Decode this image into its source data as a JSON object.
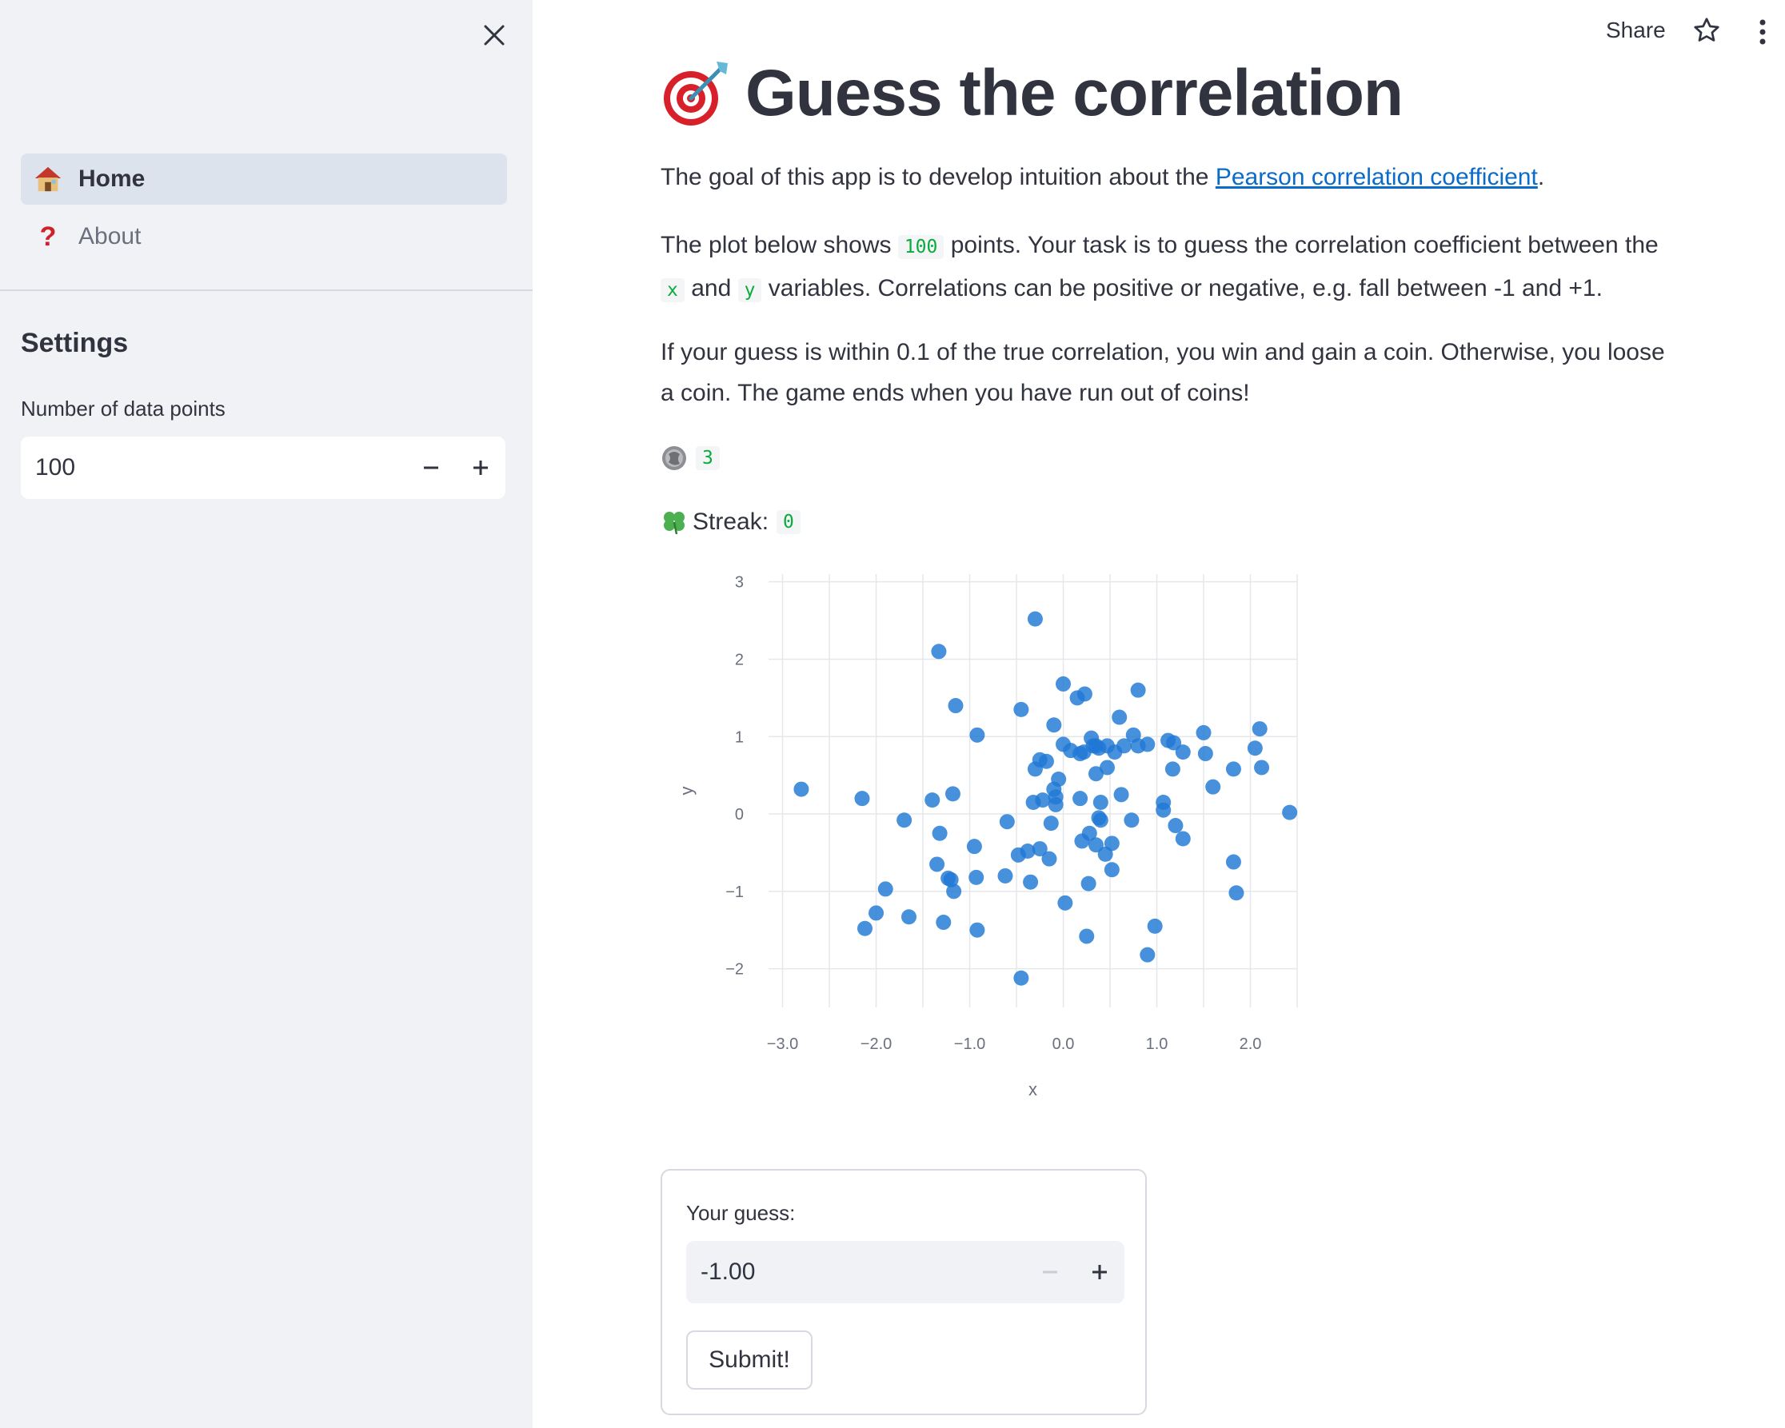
{
  "sidebar": {
    "nav": [
      {
        "label": "Home",
        "icon": "house-icon",
        "active": true
      },
      {
        "label": "About",
        "icon": "question-mark-icon",
        "active": false
      }
    ],
    "settings_title": "Settings",
    "points_label": "Number of data points",
    "points_value": "100"
  },
  "header": {
    "share_label": "Share"
  },
  "main": {
    "title": "Guess the correlation",
    "intro_prefix": "The goal of this app is to develop intuition about the ",
    "intro_link": "Pearson correlation coefficient",
    "intro_suffix": ".",
    "task_1": "The plot below shows ",
    "task_points": "100",
    "task_2": " points. Your task is to guess the correlation coefficient between the ",
    "task_x": "x",
    "task_3": " and ",
    "task_y": "y",
    "task_4": " variables. Correlations can be positive or negative, e.g. fall between -1 and +1.",
    "rules": "If your guess is within 0.1 of the true correlation, you win and gain a coin. Otherwise, you loose a coin. The game ends when you have run out of coins!",
    "coins": "3",
    "streak_label": "Streak:",
    "streak_value": "0",
    "guess_label": "Your guess:",
    "guess_value": "-1.00",
    "submit_label": "Submit!"
  },
  "colors": {
    "point": "#1f77d4",
    "accent_link": "#0b6bc8",
    "code_green": "#09ab3b"
  },
  "chart_data": {
    "type": "scatter",
    "xlabel": "x",
    "ylabel": "y",
    "xlim": [
      -3.15,
      2.5
    ],
    "ylim": [
      -2.5,
      3.1
    ],
    "xticks": [
      -3.0,
      -2.0,
      -1.0,
      0.0,
      1.0,
      2.0
    ],
    "xtick_labels": [
      "−3.0",
      "−2.0",
      "−1.0",
      "0.0",
      "1.0",
      "2.0"
    ],
    "yticks": [
      3,
      2,
      1,
      0,
      -1,
      -2
    ],
    "ytick_labels": [
      "3",
      "2",
      "1",
      "0",
      "−1",
      "−2"
    ],
    "grid": true,
    "points": [
      [
        -2.8,
        0.32
      ],
      [
        -2.15,
        0.2
      ],
      [
        -2.12,
        -1.48
      ],
      [
        -2.0,
        -1.28
      ],
      [
        -1.9,
        -0.97
      ],
      [
        -1.7,
        -0.08
      ],
      [
        -1.65,
        -1.33
      ],
      [
        -1.4,
        0.18
      ],
      [
        -1.33,
        2.1
      ],
      [
        -1.32,
        -0.25
      ],
      [
        -1.35,
        -0.65
      ],
      [
        -1.28,
        -1.4
      ],
      [
        -1.23,
        -0.83
      ],
      [
        -1.18,
        0.26
      ],
      [
        -1.15,
        1.4
      ],
      [
        -1.17,
        -1.0
      ],
      [
        -1.2,
        -0.85
      ],
      [
        -0.95,
        -0.42
      ],
      [
        -0.92,
        1.02
      ],
      [
        -0.93,
        -0.82
      ],
      [
        -0.92,
        -1.5
      ],
      [
        -0.62,
        -0.8
      ],
      [
        -0.6,
        -0.1
      ],
      [
        -0.48,
        -0.53
      ],
      [
        -0.45,
        1.35
      ],
      [
        -0.45,
        -2.12
      ],
      [
        -0.38,
        -0.48
      ],
      [
        -0.35,
        -0.88
      ],
      [
        -0.32,
        0.15
      ],
      [
        -0.3,
        0.58
      ],
      [
        -0.3,
        2.52
      ],
      [
        -0.25,
        0.7
      ],
      [
        -0.25,
        -0.45
      ],
      [
        -0.22,
        0.18
      ],
      [
        -0.18,
        0.68
      ],
      [
        -0.15,
        -0.58
      ],
      [
        -0.13,
        -0.12
      ],
      [
        -0.1,
        1.15
      ],
      [
        -0.1,
        0.32
      ],
      [
        -0.08,
        0.12
      ],
      [
        -0.08,
        0.22
      ],
      [
        -0.05,
        0.45
      ],
      [
        0.0,
        1.68
      ],
      [
        0.0,
        0.9
      ],
      [
        0.02,
        -1.15
      ],
      [
        0.08,
        0.82
      ],
      [
        0.15,
        1.5
      ],
      [
        0.18,
        0.78
      ],
      [
        0.18,
        0.2
      ],
      [
        0.2,
        -0.35
      ],
      [
        0.22,
        0.8
      ],
      [
        0.23,
        1.55
      ],
      [
        0.25,
        -1.58
      ],
      [
        0.27,
        -0.9
      ],
      [
        0.28,
        -0.25
      ],
      [
        0.3,
        0.98
      ],
      [
        0.32,
        0.88
      ],
      [
        0.35,
        0.88
      ],
      [
        0.35,
        0.52
      ],
      [
        0.35,
        -0.4
      ],
      [
        0.38,
        0.85
      ],
      [
        0.38,
        -0.05
      ],
      [
        0.4,
        0.15
      ],
      [
        0.4,
        -0.08
      ],
      [
        0.45,
        -0.52
      ],
      [
        0.47,
        0.88
      ],
      [
        0.47,
        0.6
      ],
      [
        0.52,
        -0.38
      ],
      [
        0.52,
        -0.72
      ],
      [
        0.55,
        0.8
      ],
      [
        0.6,
        1.25
      ],
      [
        0.62,
        0.25
      ],
      [
        0.65,
        0.88
      ],
      [
        0.73,
        -0.08
      ],
      [
        0.75,
        1.02
      ],
      [
        0.8,
        1.6
      ],
      [
        0.8,
        0.88
      ],
      [
        0.9,
        0.9
      ],
      [
        0.9,
        -1.82
      ],
      [
        0.98,
        -1.45
      ],
      [
        1.07,
        0.15
      ],
      [
        1.07,
        0.05
      ],
      [
        1.12,
        0.95
      ],
      [
        1.17,
        0.58
      ],
      [
        1.18,
        0.92
      ],
      [
        1.2,
        -0.15
      ],
      [
        1.28,
        -0.32
      ],
      [
        1.28,
        0.8
      ],
      [
        1.5,
        1.05
      ],
      [
        1.52,
        0.78
      ],
      [
        1.6,
        0.35
      ],
      [
        1.82,
        0.58
      ],
      [
        1.82,
        -0.62
      ],
      [
        1.85,
        -1.02
      ],
      [
        2.05,
        0.85
      ],
      [
        2.1,
        1.1
      ],
      [
        2.12,
        0.6
      ],
      [
        2.42,
        0.02
      ]
    ]
  }
}
